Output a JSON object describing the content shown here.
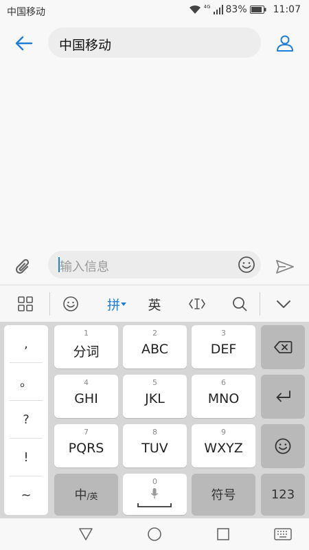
{
  "status_bar": {
    "carrier": "中国移动",
    "network_label": "4G",
    "battery": "83%",
    "time": "11:07"
  },
  "header": {
    "recipient": "中国移动"
  },
  "compose": {
    "placeholder": "输入信息"
  },
  "ime_toolbar": {
    "pinyin_label": "拼",
    "english_label": "英"
  },
  "keyboard": {
    "punctuation": [
      ",",
      "。",
      "?",
      "!",
      "~"
    ],
    "keys": [
      {
        "num": "1",
        "label": "分词"
      },
      {
        "num": "2",
        "label": "ABC"
      },
      {
        "num": "3",
        "label": "DEF"
      },
      {
        "num": "4",
        "label": "GHI"
      },
      {
        "num": "5",
        "label": "JKL"
      },
      {
        "num": "6",
        "label": "MNO"
      },
      {
        "num": "7",
        "label": "PQRS"
      },
      {
        "num": "8",
        "label": "TUV"
      },
      {
        "num": "9",
        "label": "WXYZ"
      }
    ],
    "lang_switch_main": "中",
    "lang_switch_sub": "/英",
    "space_num": "0",
    "symbols_label": "符号",
    "numbers_label": "123"
  },
  "colors": {
    "accent": "#1e7ed8",
    "keyboard_bg": "#d6d6d6",
    "key_gray": "#b9b9b9"
  }
}
